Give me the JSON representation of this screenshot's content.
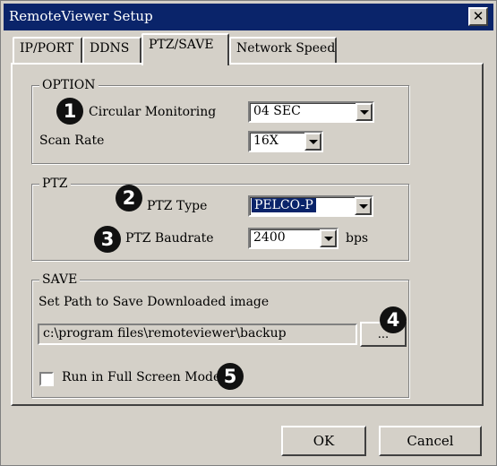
{
  "window": {
    "title": "RemoteViewer Setup",
    "close_glyph": "✕"
  },
  "tabs": [
    {
      "label": "IP/PORT"
    },
    {
      "label": "DDNS"
    },
    {
      "label": "PTZ/SAVE",
      "active": true
    },
    {
      "label": "Network Speed"
    }
  ],
  "option": {
    "legend": "OPTION",
    "circular_label": "Circular Monitoring",
    "circular_value": "04 SEC",
    "scan_label": "Scan Rate",
    "scan_value": "16X"
  },
  "ptz": {
    "legend": "PTZ",
    "type_label": "PTZ Type",
    "type_value": "PELCO-P",
    "baud_label": "PTZ Baudrate",
    "baud_value": "2400",
    "baud_unit": "bps"
  },
  "save": {
    "legend": "SAVE",
    "path_label": "Set Path to Save Downloaded image",
    "path_value": "c:\\program files\\remoteviewer\\backup",
    "browse_label": "...",
    "fullscreen_label": "Run in Full Screen Mode",
    "fullscreen_checked": false
  },
  "badges": [
    "1",
    "2",
    "3",
    "4",
    "5"
  ],
  "footer": {
    "ok_label": "OK",
    "cancel_label": "Cancel"
  },
  "colors": {
    "face": "#d4d0c8",
    "titlebar": "#0a246a",
    "selection": "#0a246a",
    "badge": "#111111"
  }
}
